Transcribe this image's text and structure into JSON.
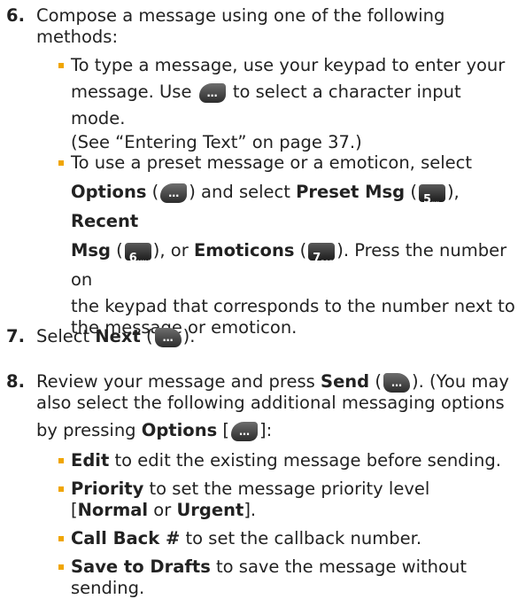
{
  "step6": {
    "number": "6.",
    "lines": [
      "Compose a message using one of the following",
      "methods:"
    ],
    "bullet1": {
      "l1": "To type a message, use your keypad to enter your",
      "l2a": "message. Use",
      "l2b": "to select a character input mode.",
      "l3": "(See “Entering Text” on page 37.)"
    },
    "bullet2": {
      "l1": "To use a preset message or a emoticon, select",
      "options": "Options",
      "paren_open": " (",
      "close_and": ") and select ",
      "preset": "Preset Msg",
      "preset_close": "), ",
      "recent": "Recent",
      "msg": "Msg",
      "msg_close": "), or ",
      "emoticons": "Emoticons",
      "emo_close": "). Press the number on",
      "l4": "the keypad that corresponds to the number next to",
      "l5": "the message or emoticon."
    }
  },
  "step7": {
    "number": "7.",
    "pre": "Select ",
    "next": "Next",
    "post": ")."
  },
  "step8": {
    "number": "8.",
    "l1a": "Review your message and press ",
    "send": "Send",
    "l1b": "). (You may",
    "l2": "also select the following additional messaging options",
    "l3a": "by pressing ",
    "options": "Options",
    "l3b": "]:",
    "bullets": [
      {
        "term": "Edit",
        "desc": " to edit the existing message before sending."
      },
      {
        "term": "Priority",
        "desc": " to set the message priority level"
      },
      {
        "term": "Call Back #",
        "desc": " to set the callback number."
      },
      {
        "term": "Save to Drafts",
        "desc": " to save the message without sending."
      }
    ],
    "priority_l2": {
      "open": "[",
      "normal": "Normal",
      "or": " or ",
      "urgent": "Urgent",
      "close": "]."
    }
  },
  "keys": {
    "menu_dots": "…",
    "key5": {
      "n": "5",
      "l": "JKL"
    },
    "key6": {
      "n": "6",
      "l": "MNO"
    },
    "key7": {
      "n": "7",
      "l": "PQRS"
    }
  }
}
